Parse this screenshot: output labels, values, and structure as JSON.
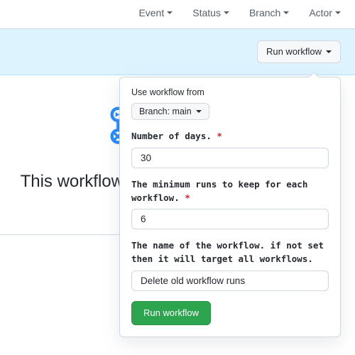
{
  "filters": {
    "event": "Event",
    "status": "Status",
    "branch": "Branch",
    "actor": "Actor"
  },
  "dispatch": {
    "run_workflow_button": "Run workflow"
  },
  "empty": {
    "title": "This workflow has no runs yet."
  },
  "popover": {
    "use_from_label": "Use workflow from",
    "branch_selector": "Branch: main",
    "fields": {
      "days": {
        "label": "Number of days.",
        "value": "30"
      },
      "min_runs": {
        "label": "The minimum runs to keep for each workflow.",
        "value": "6"
      },
      "workflow_name": {
        "label": "The name of the workflow. if not set then it will target all workflows.",
        "value": "Delete old workflow runs"
      }
    },
    "submit_label": "Run workflow"
  }
}
